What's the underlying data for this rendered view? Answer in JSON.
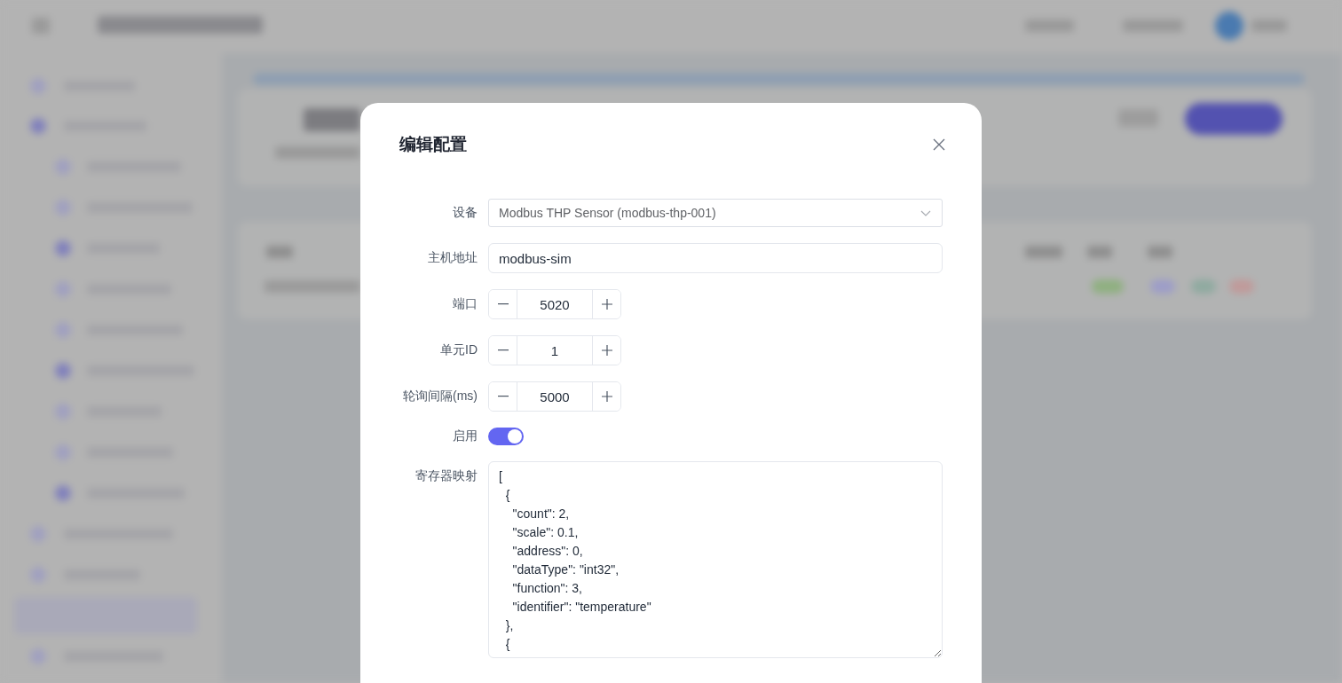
{
  "dialog": {
    "title": "编辑配置",
    "fields": [
      {
        "kind": "select",
        "label": "设备",
        "value": "Modbus THP Sensor (modbus-thp-001)"
      },
      {
        "kind": "text",
        "label": "主机地址",
        "value": "modbus-sim"
      },
      {
        "kind": "number",
        "label": "端口",
        "value": "5020"
      },
      {
        "kind": "number",
        "label": "单元ID",
        "value": "1"
      },
      {
        "kind": "number",
        "label": "轮询间隔(ms)",
        "value": "5000"
      },
      {
        "kind": "switch",
        "label": "启用",
        "on": true
      },
      {
        "kind": "textarea",
        "label": "寄存器映射",
        "value": "[\n  {\n    \"count\": 2,\n    \"scale\": 0.1,\n    \"address\": 0,\n    \"dataType\": \"int32\",\n    \"function\": 3,\n    \"identifier\": \"temperature\"\n  },\n  {"
      }
    ]
  }
}
